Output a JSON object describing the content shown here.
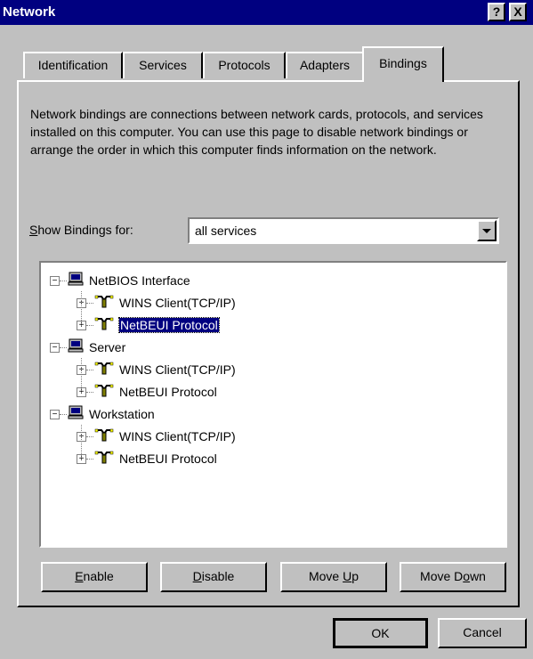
{
  "window": {
    "title": "Network",
    "help_btn": "?",
    "close_btn": "X"
  },
  "tabs": [
    {
      "label": "Identification",
      "active": false
    },
    {
      "label": "Services",
      "active": false
    },
    {
      "label": "Protocols",
      "active": false
    },
    {
      "label": "Adapters",
      "active": false
    },
    {
      "label": "Bindings",
      "active": true
    }
  ],
  "bindings": {
    "description": "Network bindings are connections between network cards, protocols, and services installed on this computer.  You can use this page to disable network bindings or arrange the order in which this computer finds information on the network.",
    "show_label": "Show Bindings for:",
    "show_value": "all services",
    "tree": [
      {
        "label": "NetBIOS Interface",
        "icon": "computer-icon",
        "children": [
          {
            "label": "WINS Client(TCP/IP)",
            "icon": "network-protocol-icon"
          },
          {
            "label": "NetBEUI Protocol",
            "icon": "network-protocol-icon",
            "selected": true
          }
        ]
      },
      {
        "label": "Server",
        "icon": "computer-icon",
        "children": [
          {
            "label": "WINS Client(TCP/IP)",
            "icon": "network-protocol-icon"
          },
          {
            "label": "NetBEUI Protocol",
            "icon": "network-protocol-icon"
          }
        ]
      },
      {
        "label": "Workstation",
        "icon": "computer-icon",
        "children": [
          {
            "label": "WINS Client(TCP/IP)",
            "icon": "network-protocol-icon"
          },
          {
            "label": "NetBEUI Protocol",
            "icon": "network-protocol-icon"
          }
        ]
      }
    ],
    "buttons": {
      "enable": "Enable",
      "disable": "Disable",
      "move_up": "Move Up",
      "move_down": "Move Down"
    }
  },
  "footer": {
    "ok": "OK",
    "cancel": "Cancel"
  },
  "colors": {
    "face": "#c0c0c0",
    "titlebar": "#000080",
    "selection": "#000080"
  }
}
